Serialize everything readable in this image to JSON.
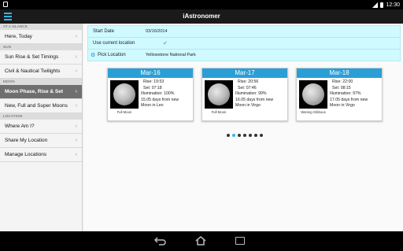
{
  "status": {
    "time": "12:30"
  },
  "app": {
    "title": "iAstronomer"
  },
  "sidebar": {
    "sections": [
      {
        "header": "AT A GLANCE",
        "items": [
          {
            "label": "Here, Today",
            "selected": false
          }
        ]
      },
      {
        "header": "SUN",
        "items": [
          {
            "label": "Sun Rise & Set Timings",
            "selected": false
          },
          {
            "label": "Civil & Nautical Twilights",
            "selected": false
          }
        ]
      },
      {
        "header": "MOON",
        "items": [
          {
            "label": "Moon Phase, Rise & Set",
            "selected": true
          },
          {
            "label": "New, Full and Super Moons",
            "selected": false
          }
        ]
      },
      {
        "header": "LOCATION",
        "items": [
          {
            "label": "Where Am I?",
            "selected": false
          },
          {
            "label": "Share My Location",
            "selected": false
          },
          {
            "label": "Manage Locations",
            "selected": false
          }
        ]
      }
    ]
  },
  "form": {
    "start_date_label": "Start Date",
    "start_date_value": "03/16/2014",
    "use_location_label": "Use current location",
    "pick_location_label": "Pick Location",
    "pick_location_value": "Yellowstone National Park"
  },
  "cards": [
    {
      "date": "Mar-16",
      "rise_label": "Rise:",
      "rise": "19:53",
      "set_label": "Set:",
      "set": "07:18",
      "illumination": "Illumination: 100%",
      "days": "15.05 days from new",
      "constellation": "Moon in Leo",
      "phase": "Full Moon"
    },
    {
      "date": "Mar-17",
      "rise_label": "Rise:",
      "rise": "20:56",
      "set_label": "Set:",
      "set": "07:46",
      "illumination": "Illumination: 99%",
      "days": "16.05 days from new",
      "constellation": "Moon in Virgo",
      "phase": "Full Moon"
    },
    {
      "date": "Mar-18",
      "rise_label": "Rise:",
      "rise": "22:00",
      "set_label": "Set:",
      "set": "08:15",
      "illumination": "Illumination: 97%",
      "days": "17.05 days from new",
      "constellation": "Moon in Virgo",
      "phase": "Waning Gibbous"
    }
  ],
  "pager": {
    "count": 7,
    "active_index": 1
  },
  "colors": {
    "accent": "#33b5e5",
    "card_header": "#2a9fd6",
    "form_bg": "#cffaff",
    "selected_item": "#6f6f6f"
  }
}
